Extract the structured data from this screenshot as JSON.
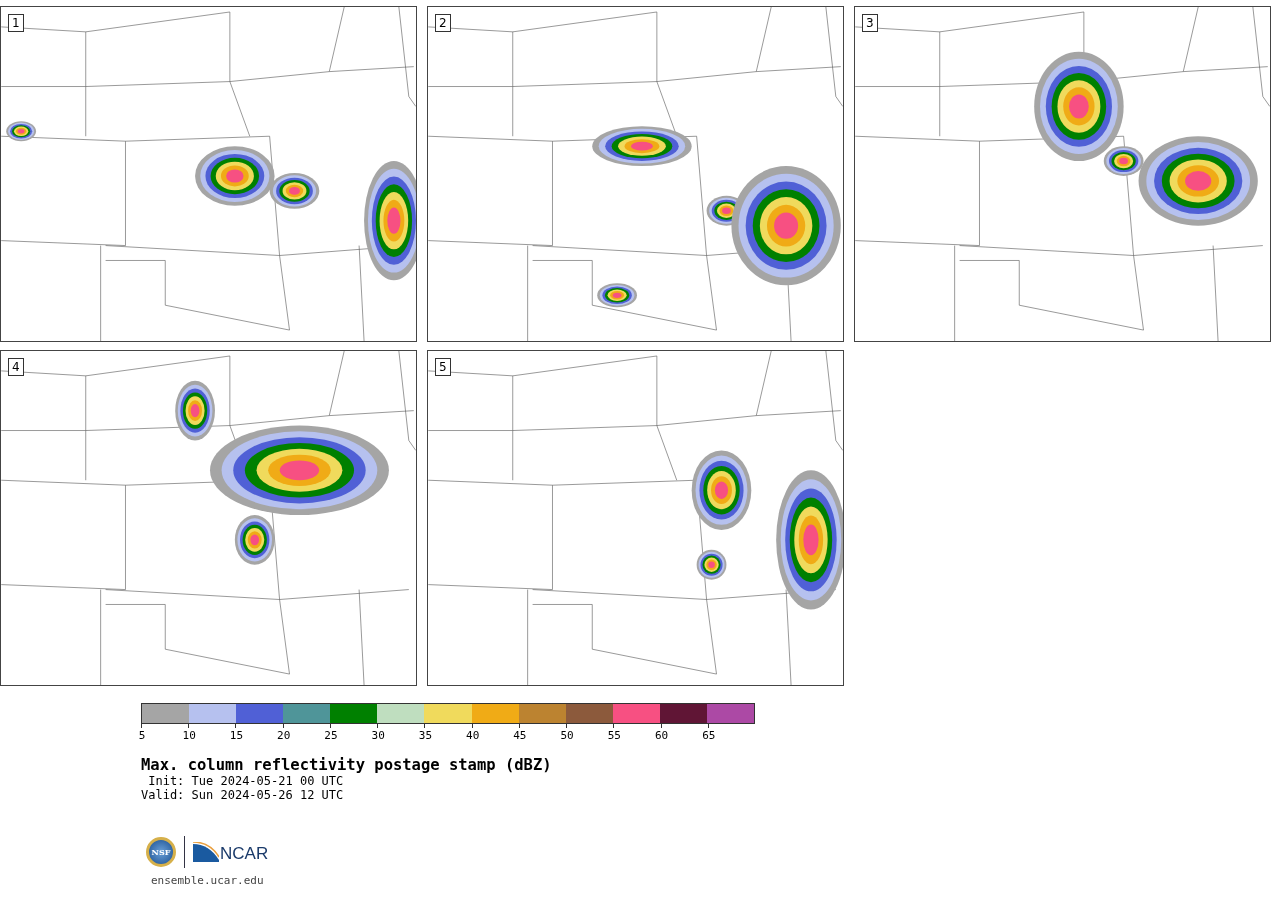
{
  "panels": [
    {
      "label": "1"
    },
    {
      "label": "2"
    },
    {
      "label": "3"
    },
    {
      "label": "4"
    },
    {
      "label": "5"
    }
  ],
  "colorbar": {
    "bins": [
      {
        "color": "#a5a5a5"
      },
      {
        "color": "#b6c1ef"
      },
      {
        "color": "#5060d6"
      },
      {
        "color": "#4f9599"
      },
      {
        "color": "#008000"
      },
      {
        "color": "#bfdebf"
      },
      {
        "color": "#f0da5c"
      },
      {
        "color": "#f0ab16"
      },
      {
        "color": "#bc8330"
      },
      {
        "color": "#8c5a3c"
      },
      {
        "color": "#f75082"
      },
      {
        "color": "#601535"
      },
      {
        "color": "#ac49a5"
      }
    ],
    "ticks": [
      "5",
      "10",
      "15",
      "20",
      "25",
      "30",
      "35",
      "40",
      "45",
      "50",
      "55",
      "60",
      "65"
    ]
  },
  "title": "Max. column reflectivity postage stamp (dBZ)",
  "init": " Init: Tue 2024-05-21 00 UTC",
  "valid": "Valid: Sun 2024-05-26 12 UTC",
  "logo": {
    "nsf": "NSF",
    "ncar": "NCAR"
  },
  "url": "ensemble.ucar.edu"
}
